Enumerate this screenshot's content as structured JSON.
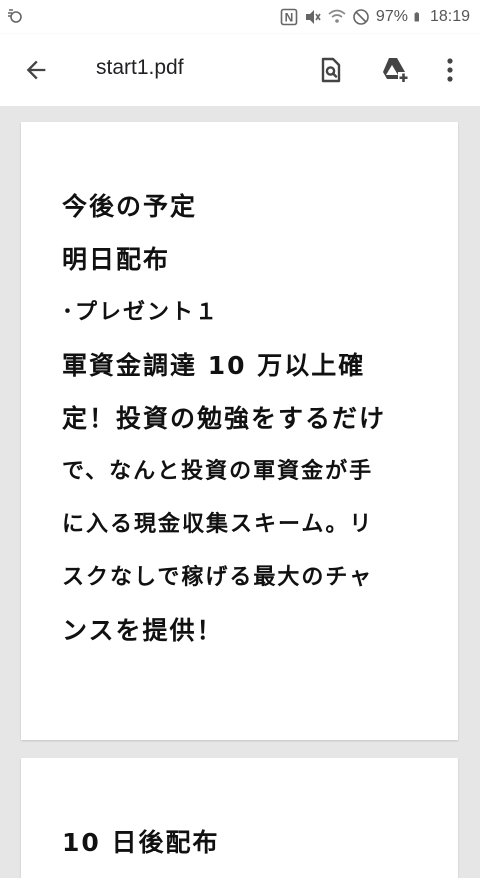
{
  "status_bar": {
    "battery": "97%",
    "time": "18:19"
  },
  "app_bar": {
    "title": "start1.pdf",
    "icons": [
      "back-arrow-icon",
      "find-in-page-icon",
      "add-to-drive-icon",
      "more-vert-icon"
    ]
  },
  "document": {
    "page1_lines": [
      "今後の予定",
      "明日配布",
      "･プレゼント１",
      "軍資金調達 10 万以上確",
      "定！投資の勉強をするだけ",
      "で、なんと投資の軍資金が手",
      "に入る現金収集スキーム。リ",
      "スクなしで稼げる最大のチャ",
      "ンスを提供！"
    ],
    "page2_lines": [
      "10 日後配布"
    ]
  },
  "colors": {
    "viewer_bg": "#e6e6e6",
    "page_bg": "#ffffff",
    "text": "#111111"
  }
}
